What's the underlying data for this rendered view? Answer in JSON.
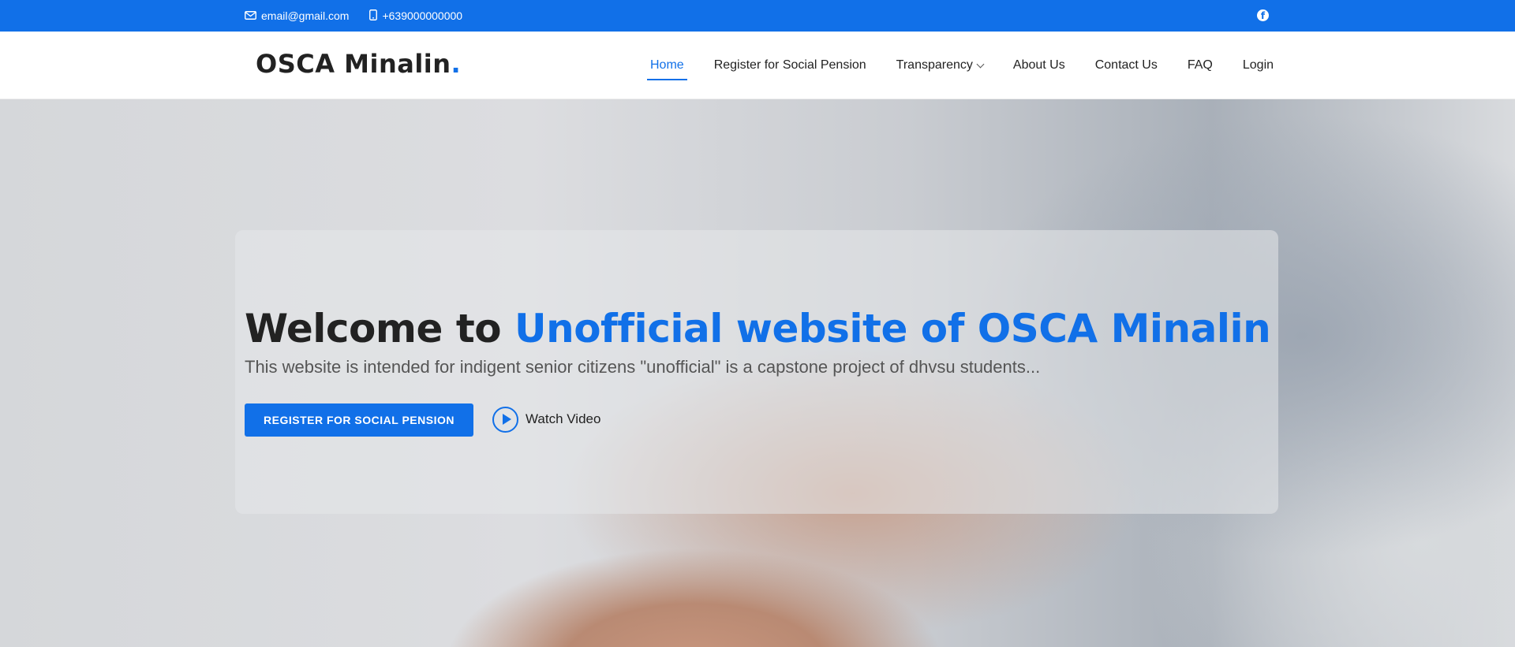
{
  "topbar": {
    "email": "email@gmail.com",
    "phone": "+639000000000",
    "icons": {
      "email": "envelope-icon",
      "phone": "phone-icon",
      "social": "facebook-icon"
    }
  },
  "header": {
    "logo_text": "OSCA Minalin",
    "logo_dot": ".",
    "nav": [
      {
        "label": "Home",
        "active": true
      },
      {
        "label": "Register for Social Pension"
      },
      {
        "label": "Transparency",
        "dropdown": true
      },
      {
        "label": "About Us"
      },
      {
        "label": "Contact Us"
      },
      {
        "label": "FAQ"
      },
      {
        "label": "Login"
      }
    ]
  },
  "hero": {
    "title_prefix": "Welcome to",
    "title_accent": "Unofficial website of OSCA Minalin",
    "subtitle": "This website is intended for indigent senior citizens \"unofficial\" is a capstone project of dhvsu students...",
    "cta_label": "REGISTER FOR SOCIAL PENSION",
    "watch_label": "Watch Video"
  },
  "colors": {
    "accent": "#1170e8",
    "text": "#222222",
    "muted": "#555555"
  }
}
